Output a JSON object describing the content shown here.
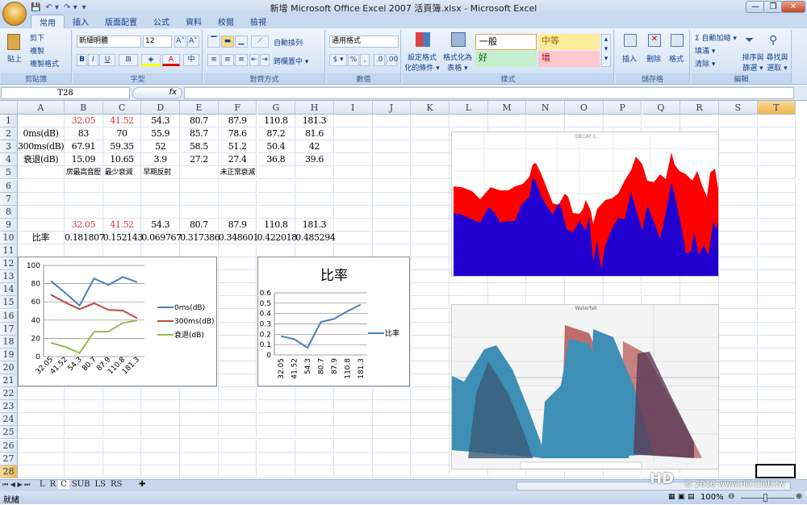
{
  "window": {
    "title": "新增 Microsoft Office Excel 2007 活頁簿.xlsx - Microsoft Excel",
    "controls": [
      "—",
      "❐",
      "✕"
    ]
  },
  "qat": [
    "💾",
    "↶ ▾",
    "↷ ▾",
    "▾"
  ],
  "tabs": [
    "常用",
    "插入",
    "版面配置",
    "公式",
    "資料",
    "校閱",
    "檢視"
  ],
  "ribbon": {
    "clipboard": {
      "paste": "貼上",
      "cut": "剪下",
      "copy": "複製",
      "format_painter": "複製格式",
      "label": "剪貼簿"
    },
    "font": {
      "name": "新細明體",
      "size": "12",
      "grow": "A˄",
      "shrink": "A˅",
      "bold": "B",
      "italic": "I",
      "underline": "U",
      "label": "字型"
    },
    "alignment": {
      "wrap": "自動換列",
      "merge": "跨欄置中 ▾",
      "label": "對齊方式"
    },
    "number": {
      "format": "通用格式",
      "currency": "$ ▾",
      "percent": "%",
      "comma": ",",
      "label": "數值"
    },
    "styles": {
      "conditional": "設定格式化的條件 ▾",
      "table": "格式化為表格 ▾",
      "normal": "一般",
      "neutral": "中等",
      "good": "好",
      "bad": "壞",
      "label": "樣式"
    },
    "cells": {
      "insert": "插入",
      "delete": "刪除",
      "format": "格式",
      "label": "儲存格"
    },
    "editing": {
      "autosum": "Σ 自動加總 ▾",
      "fill": "填滿 ▾",
      "clear": "清除 ▾",
      "sort": "排序與篩選 ▾",
      "find": "尋找與選取 ▾",
      "label": "編輯"
    }
  },
  "formula_bar": {
    "name_box": "T28",
    "fx": "fx",
    "value": ""
  },
  "columns": [
    "A",
    "B",
    "C",
    "D",
    "E",
    "F",
    "G",
    "H",
    "I",
    "J",
    "K",
    "L",
    "M",
    "N",
    "O",
    "P",
    "Q",
    "R",
    "S",
    "T"
  ],
  "rows": [
    "1",
    "2",
    "3",
    "4",
    "5",
    "6",
    "7",
    "8",
    "9",
    "10",
    "11",
    "12",
    "13",
    "14",
    "15",
    "16",
    "17",
    "18",
    "19",
    "20",
    "21",
    "22",
    "23",
    "24",
    "25",
    "26",
    "27",
    "28"
  ],
  "cells": [
    [
      "",
      "32.05",
      "41.52",
      "54.3",
      "80.7",
      "87.9",
      "110.8",
      "181.3"
    ],
    [
      "0ms(dB)",
      "83",
      "70",
      "55.9",
      "85.7",
      "78.6",
      "87.2",
      "81.6"
    ],
    [
      "300ms(dB)",
      "67.91",
      "59.35",
      "52",
      "58.5",
      "51.2",
      "50.4",
      "42"
    ],
    [
      "衰退(dB)",
      "15.09",
      "10.65",
      "3.9",
      "27.2",
      "27.4",
      "36.8",
      "39.6"
    ],
    [
      "",
      "房最高音壓",
      "最少衰減",
      "早期反射",
      "",
      "未正常衰減",
      "",
      ""
    ],
    [
      "",
      "",
      "",
      "",
      "",
      "",
      "",
      ""
    ],
    [
      "",
      "",
      "",
      "",
      "",
      "",
      "",
      ""
    ],
    [
      "",
      "",
      "",
      "",
      "",
      "",
      "",
      ""
    ],
    [
      "",
      "32.05",
      "41.52",
      "54.3",
      "80.7",
      "87.9",
      "110.8",
      "181.3"
    ],
    [
      "比率",
      "0.181807",
      "0.152143",
      "0.069767",
      "0.317386",
      "0.348601",
      "0.422018",
      "0.485294"
    ]
  ],
  "red_text_color": "#e03a3a",
  "chart_data": [
    {
      "type": "line",
      "title": "",
      "categories": [
        "32.05",
        "41.52",
        "54.3",
        "80.7",
        "87.9",
        "110.8",
        "181.3"
      ],
      "ylim": [
        0,
        100
      ],
      "yticks": [
        "0",
        "20",
        "40",
        "60",
        "80",
        "100"
      ],
      "legend": "right",
      "series": [
        {
          "name": "0ms(dB)",
          "color": "#4a7ebb",
          "values": [
            83,
            70,
            55.9,
            85.7,
            78.6,
            87.2,
            81.6
          ]
        },
        {
          "name": "300ms(dB)",
          "color": "#be4b48",
          "values": [
            67.91,
            59.35,
            52,
            58.5,
            51.2,
            50.4,
            42
          ]
        },
        {
          "name": "衰退(dB)",
          "color": "#98b954",
          "values": [
            15.09,
            10.65,
            3.9,
            27.2,
            27.4,
            36.8,
            39.6
          ]
        }
      ]
    },
    {
      "type": "line",
      "title": "比率",
      "categories": [
        "32.05",
        "41.52",
        "54.3",
        "80.7",
        "87.9",
        "110.8",
        "181.3"
      ],
      "ylim": [
        0,
        0.6
      ],
      "yticks": [
        "0",
        "0.1",
        "0.2",
        "0.3",
        "0.4",
        "0.5",
        "0.6"
      ],
      "legend": "right",
      "series": [
        {
          "name": "比率",
          "color": "#4a7ebb",
          "values": [
            0.181807,
            0.152143,
            0.069767,
            0.317386,
            0.348601,
            0.422018,
            0.485294
          ]
        }
      ]
    }
  ],
  "images": {
    "decay_title": "DECAY C",
    "waterfall_title": "Waterfall"
  },
  "sheets": [
    "L",
    "R",
    "C",
    "SUB",
    "LS",
    "RS"
  ],
  "watermark": "© 2018 www.HD.Club.tw",
  "status": {
    "ready": "就緒",
    "zoom": "100%"
  }
}
